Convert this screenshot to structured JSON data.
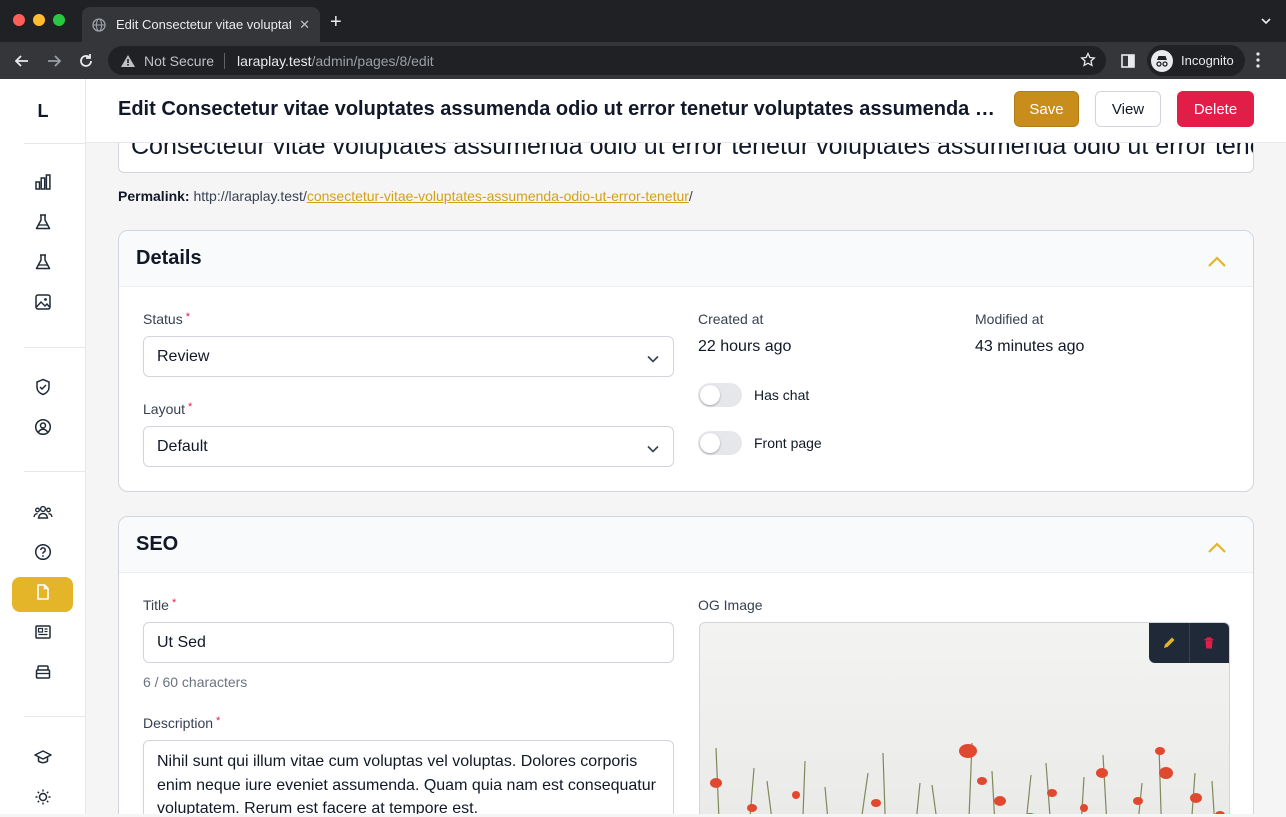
{
  "browser": {
    "tab_title": "Edit Consectetur vitae voluptat",
    "security_label": "Not Secure",
    "url_host": "laraplay.test",
    "url_path": "/admin/pages/8/edit",
    "profile_label": "Incognito"
  },
  "sidebar": {
    "logo": "L",
    "items": [
      {
        "icon": "chart-bar-icon"
      },
      {
        "icon": "beaker-icon"
      },
      {
        "icon": "beaker-icon"
      },
      {
        "icon": "photo-icon"
      },
      {
        "icon": "shield-check-icon"
      },
      {
        "icon": "user-circle-icon"
      },
      {
        "icon": "users-icon"
      },
      {
        "icon": "question-icon"
      },
      {
        "icon": "document-icon",
        "active": true
      },
      {
        "icon": "newspaper-icon"
      },
      {
        "icon": "archive-icon"
      },
      {
        "icon": "academic-cap-icon"
      },
      {
        "icon": "light-bulb-icon"
      }
    ]
  },
  "header": {
    "title": "Edit Consectetur vitae voluptates assumenda odio ut error tenetur voluptates assumenda odio ut error tenetur",
    "save_label": "Save",
    "view_label": "View",
    "delete_label": "Delete"
  },
  "page": {
    "title_value": "Consectetur vitae voluptates assumenda odio ut error tenetur voluptates assumenda odio ut error tenetur",
    "permalink_label": "Permalink:",
    "permalink_base": "http://laraplay.test/",
    "permalink_slug": "consectetur-vitae-voluptates-assumenda-odio-ut-error-tenetur",
    "permalink_suffix": "/"
  },
  "details": {
    "heading": "Details",
    "status_label": "Status",
    "status_value": "Review",
    "layout_label": "Layout",
    "layout_value": "Default",
    "created_label": "Created at",
    "created_value": "22 hours ago",
    "modified_label": "Modified at",
    "modified_value": "43 minutes ago",
    "has_chat_label": "Has chat",
    "has_chat_on": false,
    "front_page_label": "Front page",
    "front_page_on": false
  },
  "seo": {
    "heading": "SEO",
    "title_label": "Title",
    "title_value": "Ut Sed",
    "title_count": "6 / 60 characters",
    "description_label": "Description",
    "description_value": "Nihil sunt qui illum vitae cum voluptas vel voluptas. Dolores corporis enim neque iure eveniet assumenda. Quam quia nam est consequatur voluptatem. Rerum est facere at tempore est.",
    "og_label": "OG Image"
  },
  "colors": {
    "accent": "#c98d1b",
    "active_nav": "#e4b429",
    "danger": "#e11d48",
    "link": "#d4a017"
  }
}
